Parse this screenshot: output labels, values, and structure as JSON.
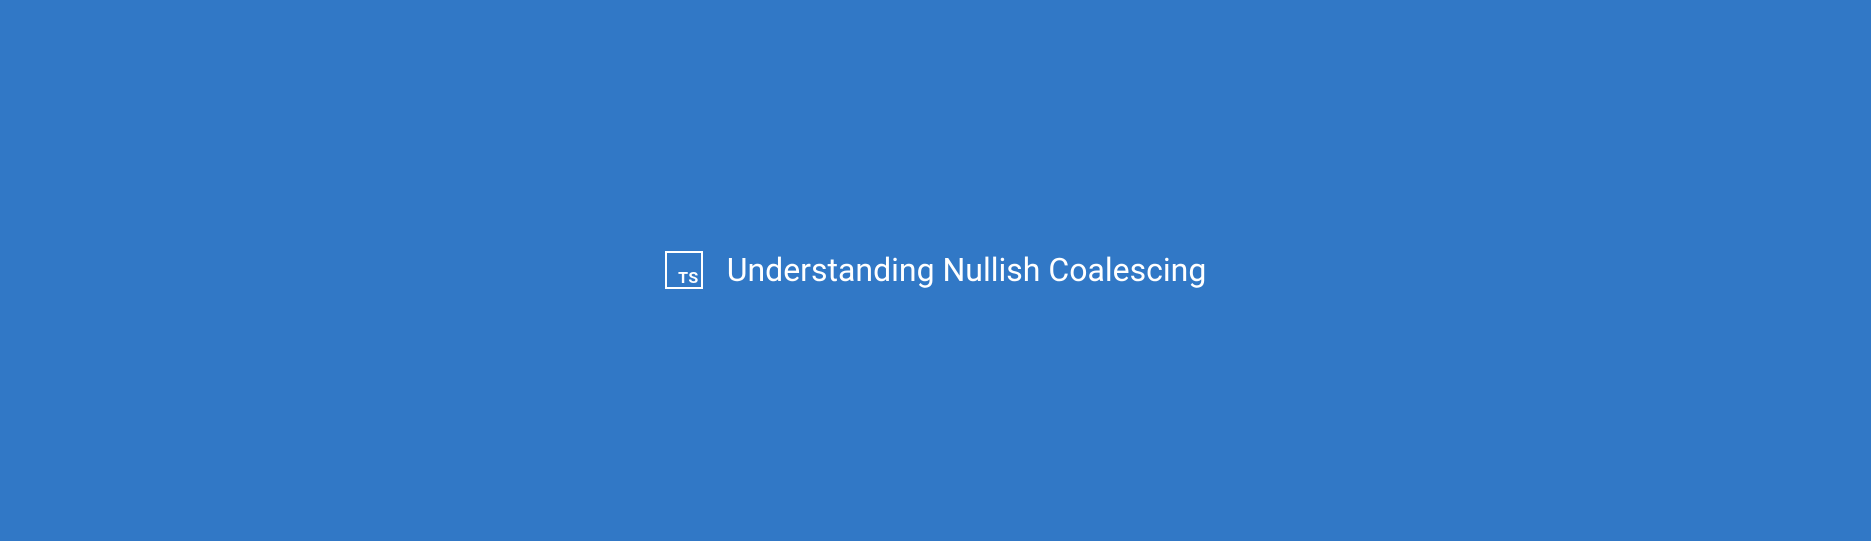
{
  "hero": {
    "icon_label": "TS",
    "title": "Understanding Nullish Coalescing"
  }
}
